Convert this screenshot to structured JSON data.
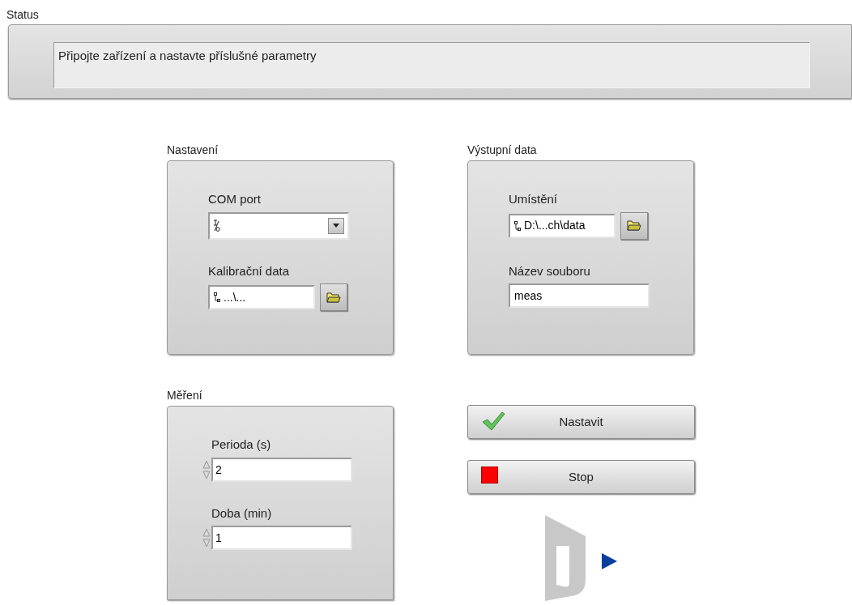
{
  "status": {
    "label": "Status",
    "message": "Připojte zařízení a nastavte příslušné parametry"
  },
  "settings": {
    "title": "Nastavení",
    "fields": [
      {
        "kind": "dropdown",
        "label": "COM port"
      },
      {
        "kind": "path",
        "label": "Kalibrační data",
        "value": "...\\..."
      }
    ]
  },
  "output": {
    "title": "Výstupní data",
    "fields": [
      {
        "kind": "path",
        "label": "Umístění",
        "value": "D:\\...ch\\data"
      },
      {
        "kind": "text",
        "label": "Název souboru",
        "value": "meas"
      }
    ]
  },
  "measurement": {
    "title": "Měření",
    "fields": [
      {
        "kind": "numeric",
        "label": "Perioda (s)",
        "value": "2"
      },
      {
        "kind": "numeric",
        "label": "Doba (min)",
        "value": "1"
      }
    ]
  },
  "buttons": [
    {
      "kind": "ok",
      "label": "Nastavit"
    },
    {
      "kind": "stop",
      "label": "Stop"
    }
  ]
}
